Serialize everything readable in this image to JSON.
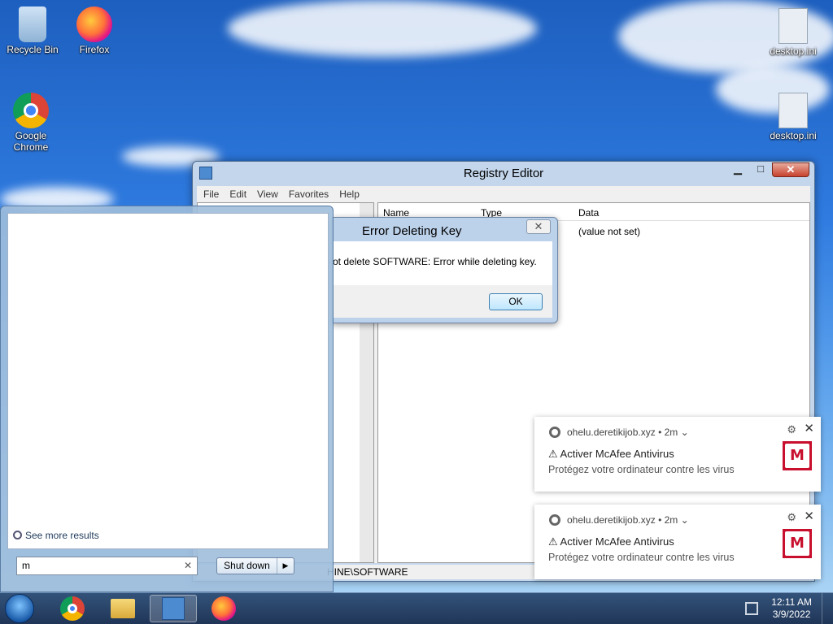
{
  "desktop": {
    "icons": [
      {
        "label": "Recycle Bin"
      },
      {
        "label": "Firefox"
      },
      {
        "label": "Google Chrome"
      },
      {
        "label": "desktop.ini"
      },
      {
        "label": "desktop.ini"
      }
    ]
  },
  "regedit": {
    "title": "Registry Editor",
    "menu": [
      "File",
      "Edit",
      "View",
      "Favorites",
      "Help"
    ],
    "columns": {
      "name": "Name",
      "type": "Type",
      "data": "Data"
    },
    "row": {
      "data": "(value not set)"
    },
    "status": "HINE\\SOFTWARE"
  },
  "dialog": {
    "title": "Error Deleting Key",
    "message": "ot delete SOFTWARE:  Error while deleting key.",
    "ok": "OK"
  },
  "startmenu": {
    "see_more": "See more results",
    "search_value": "m",
    "shutdown": "Shut down"
  },
  "notifications": [
    {
      "source": "ohelu.deretikijob.xyz",
      "age": "2m",
      "title": "⚠ Activer McAfee Antivirus",
      "body": "Protégez votre ordinateur contre les virus"
    },
    {
      "source": "ohelu.deretikijob.xyz",
      "age": "2m",
      "title": "⚠ Activer McAfee Antivirus",
      "body": "Protégez votre ordinateur contre les virus"
    }
  ],
  "taskbar": {
    "time": "12:11 AM",
    "date": "3/9/2022"
  }
}
